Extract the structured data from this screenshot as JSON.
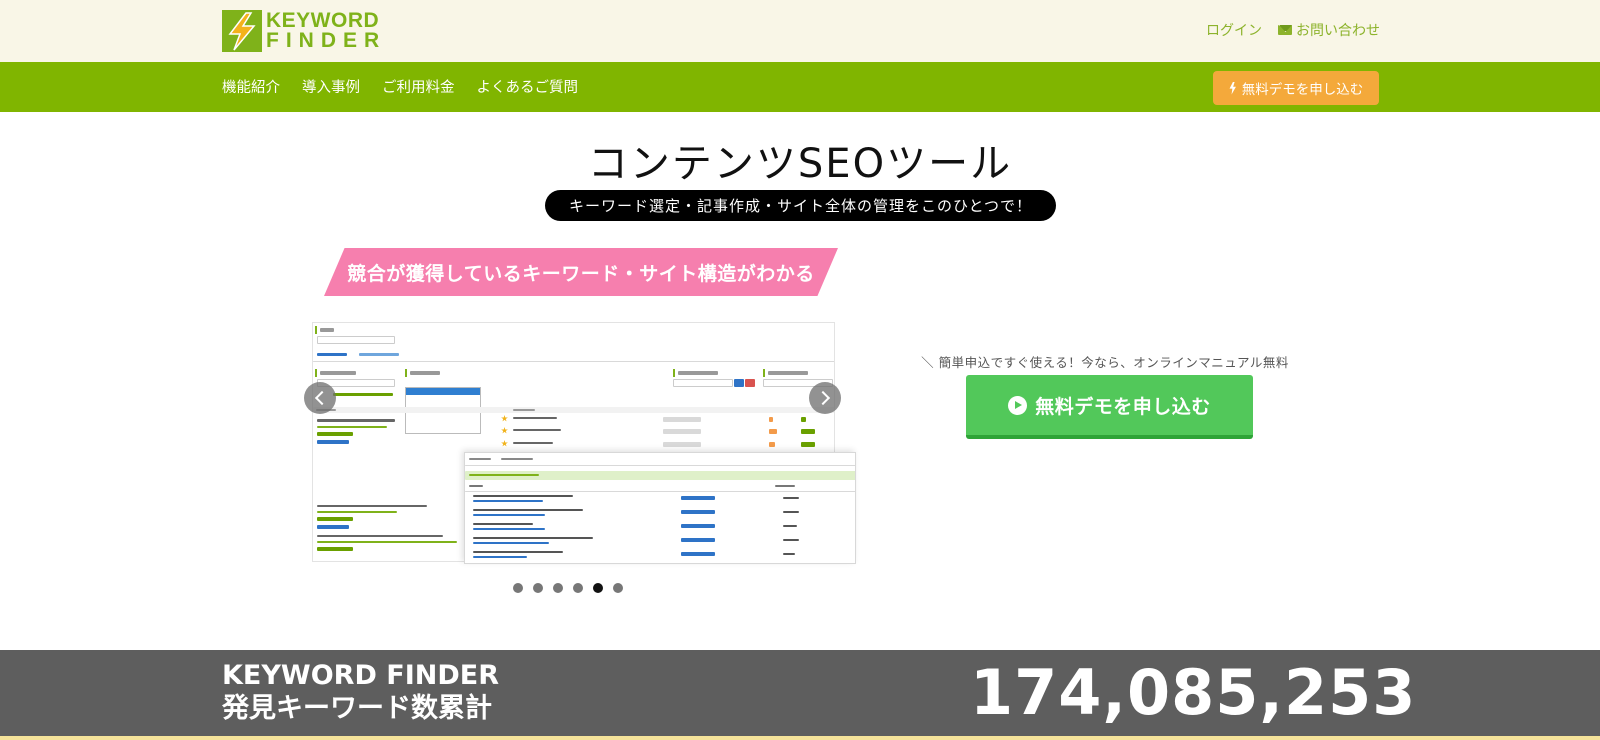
{
  "header": {
    "logo": {
      "line1": "KEYWORD",
      "line2": "FINDER",
      "accent": "#7fb21a",
      "mark_color": "#f3b21c"
    },
    "login_label": "ログイン",
    "contact_label": "お問い合わせ",
    "contact_icon": "mail-icon"
  },
  "nav": {
    "items": [
      {
        "label": "機能紹介"
      },
      {
        "label": "導入事例"
      },
      {
        "label": "ご利用料金"
      },
      {
        "label": "よくあるご質問"
      }
    ],
    "cta_label": "無料デモを申し込む",
    "cta_icon": "bolt-icon",
    "bg_color": "#80b500",
    "cta_color": "#f4a93b"
  },
  "hero": {
    "title": "コンテンツSEOツール",
    "tagline": "キーワード選定・記事作成・サイト全体の管理をこのひとつで！"
  },
  "carousel": {
    "slide_title": "競合が獲得しているキーワード・サイト構造がわかる",
    "slide_color": "#f67fae",
    "slide_count": 6,
    "active_index": 4,
    "prev_icon": "chevron-left-icon",
    "next_icon": "chevron-right-icon"
  },
  "cta": {
    "note": "＼ 簡単申込ですぐ使える！今なら、オンラインマニュアル無料GET！ ／",
    "button_label": "無料デモを申し込む",
    "button_icon": "play-circle-icon",
    "button_color": "#52c85a"
  },
  "counter": {
    "label_line1": "KEYWORD FINDER",
    "label_line2": "発見キーワード数累計",
    "value": "174,085,253",
    "bg_color": "#5e5e5e"
  }
}
